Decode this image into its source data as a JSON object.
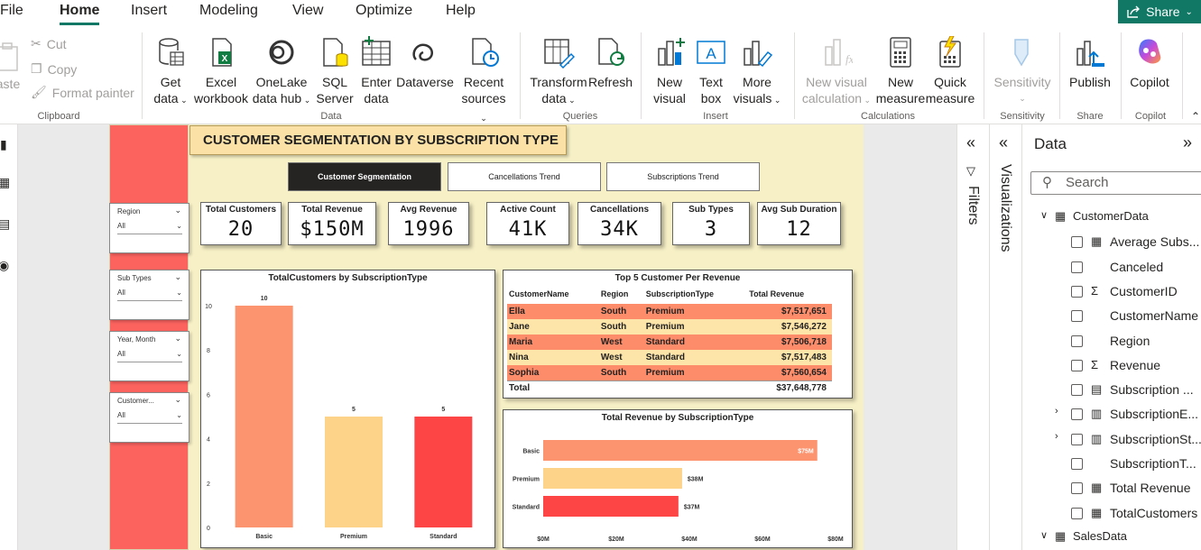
{
  "menu": {
    "file": "File",
    "home": "Home",
    "insert": "Insert",
    "modeling": "Modeling",
    "view": "View",
    "optimize": "Optimize",
    "help": "Help",
    "share": "Share"
  },
  "ribbon": {
    "clipboard": {
      "paste": "aste",
      "cut": "Cut",
      "copy": "Copy",
      "format_painter": "Format painter",
      "group": "Clipboard"
    },
    "data": {
      "get_data": [
        "Get",
        "data"
      ],
      "excel": [
        "Excel",
        "workbook"
      ],
      "onelake": [
        "OneLake",
        "data hub"
      ],
      "sql": [
        "SQL",
        "Server"
      ],
      "enter": [
        "Enter",
        "data"
      ],
      "dataverse": "Dataverse",
      "recent": [
        "Recent",
        "sources"
      ],
      "group": "Data"
    },
    "queries": {
      "transform": [
        "Transform",
        "data"
      ],
      "refresh": "Refresh",
      "group": "Queries"
    },
    "insert": {
      "new_visual": [
        "New",
        "visual"
      ],
      "text_box": [
        "Text",
        "box"
      ],
      "more_visuals": [
        "More",
        "visuals"
      ],
      "group": "Insert"
    },
    "calculations": {
      "new_visual_calc": [
        "New visual",
        "calculation"
      ],
      "new_measure": [
        "New",
        "measure"
      ],
      "quick_measure": [
        "Quick",
        "measure"
      ],
      "group": "Calculations"
    },
    "sensitivity": {
      "label": "Sensitivity",
      "group": "Sensitivity"
    },
    "share": {
      "publish": "Publish",
      "group": "Share"
    },
    "copilot": {
      "label": "Copilot",
      "group": "Copilot"
    }
  },
  "report": {
    "title": "CUSTOMER SEGMENTATION BY SUBSCRIPTION TYPE",
    "nav_buttons": [
      "Customer Segmentation",
      "Cancellations Trend",
      "Subscriptions Trend"
    ],
    "kpis": [
      {
        "label": "Total Customers",
        "value": "20"
      },
      {
        "label": "Total Revenue",
        "value": "$150M"
      },
      {
        "label": "Avg Revenue",
        "value": "1996"
      },
      {
        "label": "Active Count",
        "value": "41K"
      },
      {
        "label": "Cancellations",
        "value": "34K"
      },
      {
        "label": "Sub Types",
        "value": "3"
      },
      {
        "label": "Avg Sub Duration",
        "value": "12"
      }
    ],
    "slicers": [
      {
        "title": "Region",
        "value": "All"
      },
      {
        "title": "Sub Types",
        "value": "All"
      },
      {
        "title": "Year, Month",
        "value": "All"
      },
      {
        "title": "Customer...",
        "value": "All"
      }
    ],
    "table": {
      "title": "Top 5 Customer Per Revenue",
      "headers": [
        "CustomerName",
        "Region",
        "SubscriptionType",
        "Total Revenue"
      ],
      "rows": [
        [
          "Ella",
          "South",
          "Premium",
          "$7,517,651"
        ],
        [
          "Jane",
          "South",
          "Premium",
          "$7,546,272"
        ],
        [
          "Maria",
          "West",
          "Standard",
          "$7,506,718"
        ],
        [
          "Nina",
          "West",
          "Standard",
          "$7,517,483"
        ],
        [
          "Sophia",
          "South",
          "Premium",
          "$7,560,654"
        ]
      ],
      "total_label": "Total",
      "total_value": "$37,648,778"
    }
  },
  "chart_data": [
    {
      "type": "bar",
      "title": "TotalCustomers by SubscriptionType",
      "categories": [
        "Basic",
        "Premium",
        "Standard"
      ],
      "values": [
        10,
        5,
        5
      ],
      "data_labels": [
        "10",
        "5",
        "5"
      ],
      "ylim": [
        0,
        10
      ],
      "yticks": [
        0,
        2,
        4,
        6,
        8,
        10
      ],
      "colors": [
        "#fd9470",
        "#fdd289",
        "#fd4545"
      ]
    },
    {
      "type": "bar",
      "orientation": "horizontal",
      "title": "Total Revenue by SubscriptionType",
      "categories": [
        "Basic",
        "Premium",
        "Standard"
      ],
      "values": [
        75,
        38,
        37
      ],
      "data_labels": [
        "$75M",
        "$38M",
        "$37M"
      ],
      "xlim": [
        0,
        80
      ],
      "xticks": [
        "$0M",
        "$20M",
        "$40M",
        "$60M",
        "$80M"
      ],
      "colors": [
        "#fd9470",
        "#fdd289",
        "#fd4545"
      ]
    }
  ],
  "panes": {
    "filters": "Filters",
    "visualizations": "Visualizations",
    "data": "Data",
    "search_placeholder": "Search"
  },
  "fields": [
    {
      "name": "CustomerData",
      "kind": "table"
    },
    {
      "name": "Average Subs...",
      "kind": "measure"
    },
    {
      "name": "Canceled",
      "kind": "plain"
    },
    {
      "name": "CustomerID",
      "kind": "sum"
    },
    {
      "name": "CustomerName",
      "kind": "plain"
    },
    {
      "name": "Region",
      "kind": "plain"
    },
    {
      "name": "Revenue",
      "kind": "sum"
    },
    {
      "name": "Subscription ...",
      "kind": "calendar"
    },
    {
      "name": "SubscriptionE...",
      "kind": "hier"
    },
    {
      "name": "SubscriptionSt...",
      "kind": "hier"
    },
    {
      "name": "SubscriptionT...",
      "kind": "plain"
    },
    {
      "name": "Total Revenue",
      "kind": "measure"
    },
    {
      "name": "TotalCustomers",
      "kind": "measure"
    },
    {
      "name": "SalesData",
      "kind": "table"
    }
  ],
  "colors": {
    "accent": "#117865",
    "page_bg": "#f7f0c6",
    "red_bar": "#fc635f"
  }
}
